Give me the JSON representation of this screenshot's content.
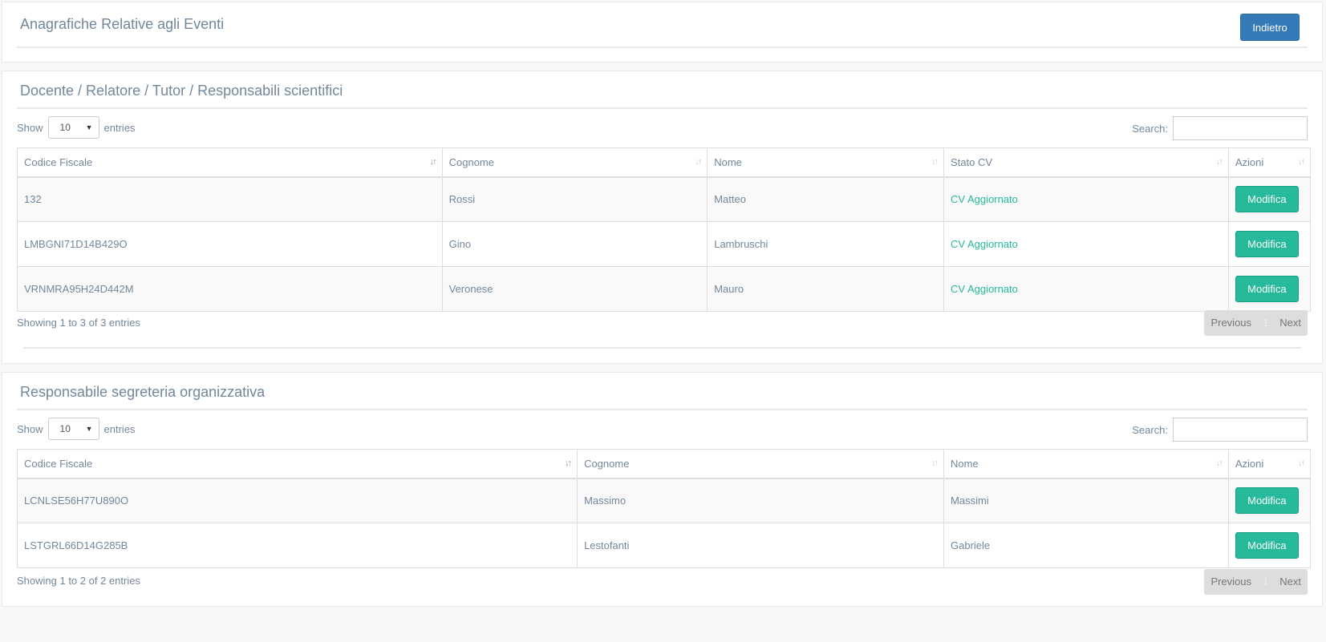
{
  "header": {
    "title": "Anagrafiche Relative agli Eventi",
    "back_label": "Indietro"
  },
  "section1": {
    "title": "Docente / Relatore / Tutor / Responsabili scientifici",
    "show_label": "Show",
    "entries_value": "10",
    "entries_label": "entries",
    "search_label": "Search:",
    "search_value": "",
    "columns": [
      "Codice Fiscale",
      "Cognome",
      "Nome",
      "Stato CV",
      "Azioni"
    ],
    "rows": [
      {
        "cf": "132",
        "cognome": "Rossi",
        "nome": "Matteo",
        "stato": "CV Aggiornato",
        "azione": "Modifica"
      },
      {
        "cf": "LMBGNI71D14B429O",
        "cognome": "Gino",
        "nome": "Lambruschi",
        "stato": "CV Aggiornato",
        "azione": "Modifica"
      },
      {
        "cf": "VRNMRA95H24D442M",
        "cognome": "Veronese",
        "nome": "Mauro",
        "stato": "CV Aggiornato",
        "azione": "Modifica"
      }
    ],
    "info": "Showing 1 to 3 of 3 entries",
    "pager": {
      "prev": "Previous",
      "page": "1",
      "next": "Next"
    }
  },
  "section2": {
    "title": "Responsabile segreteria organizzativa",
    "show_label": "Show",
    "entries_value": "10",
    "entries_label": "entries",
    "search_label": "Search:",
    "search_value": "",
    "columns": [
      "Codice Fiscale",
      "Cognome",
      "Nome",
      "Azioni"
    ],
    "rows": [
      {
        "cf": "LCNLSE56H77U890O",
        "cognome": "Massimo",
        "nome": "Massimi",
        "azione": "Modifica"
      },
      {
        "cf": "LSTGRL66D14G285B",
        "cognome": "Lestofanti",
        "nome": "Gabriele",
        "azione": "Modifica"
      }
    ],
    "info": "Showing 1 to 2 of 2 entries",
    "pager": {
      "prev": "Previous",
      "page": "1",
      "next": "Next"
    }
  },
  "colors": {
    "primary": "#337ab7",
    "success": "#26b99a",
    "text": "#73879c"
  }
}
